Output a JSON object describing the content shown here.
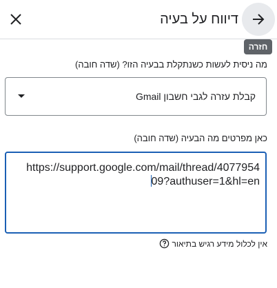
{
  "header": {
    "title": "דיווח על בעיה",
    "back_icon": "arrow-forward-icon",
    "close_icon": "close-icon",
    "back_tooltip": "חזרה"
  },
  "form": {
    "question1_label": "מה ניסית לעשות כשנתקלת בבעיה הזו? (שדה חובה)",
    "question1_value": "קבלת עזרה לגבי חשבון Gmail",
    "question2_label": "כאן מפרטים מה הבעיה (שדה חובה)",
    "description_line1": "https://support.google.com/mail/thread/4077954",
    "description_line2": "09?authuser=1&hl=en",
    "hint": "אין לכלול מידע רגיש בתיאור",
    "hint_icon": "help-circle-icon"
  },
  "colors": {
    "focus_border": "#1a5fb4",
    "tooltip_bg": "#5f6368"
  }
}
